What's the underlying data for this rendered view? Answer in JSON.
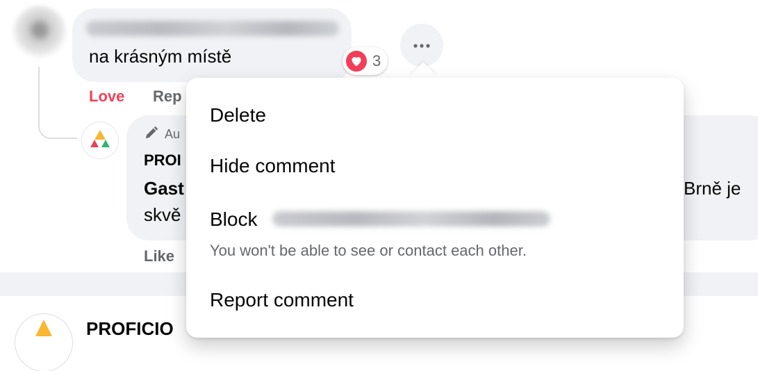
{
  "comment": {
    "text": "na krásným místě",
    "reaction_count": "3",
    "love_label": "Love",
    "reply_label": "Rep"
  },
  "reply": {
    "badge_label": "Au",
    "author_name": "PROI",
    "line1_start": "Gast",
    "line1_end": "Brně je",
    "line2": "skvě",
    "like_label": "Like"
  },
  "next_post": {
    "name": "PROFICIO"
  },
  "menu": {
    "delete_label": "Delete",
    "hide_label": "Hide comment",
    "block_label": "Block",
    "block_subtitle": "You won't be able to see or contact each other.",
    "report_label": "Report comment"
  },
  "colors": {
    "love": "#f33e58",
    "secondary_text": "#65676b",
    "bubble_bg": "#f0f2f5"
  },
  "icons": [
    "heart-icon",
    "more-options-icon",
    "pencil-icon",
    "page-logo-icon"
  ]
}
